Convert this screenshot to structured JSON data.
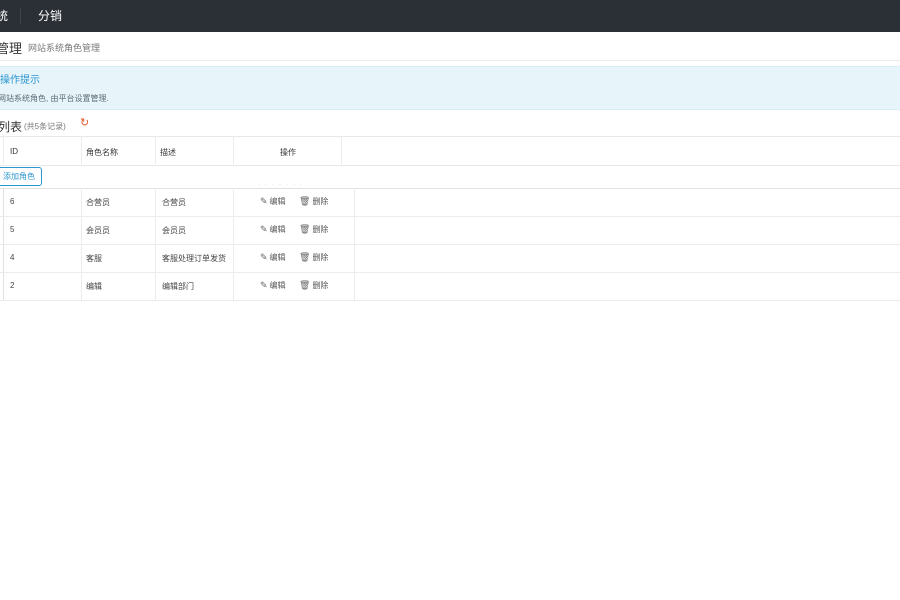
{
  "topbar": {
    "prev_item": "统",
    "fenxiao": "分销"
  },
  "header": {
    "title": "管理",
    "subtitle": "网站系统角色管理"
  },
  "tip": {
    "title": "操作提示",
    "text": "网站系统角色, 由平台设置管理."
  },
  "list": {
    "title": "列表",
    "count": "(共5条记录)",
    "refresh_icon": "refresh-icon"
  },
  "table": {
    "columns": [
      "ID",
      "角色名称",
      "描述",
      "操作"
    ],
    "add_button": "添加角色",
    "edit_label": "编辑",
    "delete_label": "删除",
    "rows": [
      {
        "id": "6",
        "name": "合营员",
        "desc": "合营员"
      },
      {
        "id": "5",
        "name": "会员员",
        "desc": "会员员"
      },
      {
        "id": "4",
        "name": "客服",
        "desc": "客服处理订单发货"
      },
      {
        "id": "2",
        "name": "编辑",
        "desc": "编辑部门"
      }
    ]
  },
  "colors": {
    "topbar": "#2b2f36",
    "accent": "#2b95cf",
    "tip_bg": "#e7f5fb",
    "refresh": "#e05a2b"
  }
}
